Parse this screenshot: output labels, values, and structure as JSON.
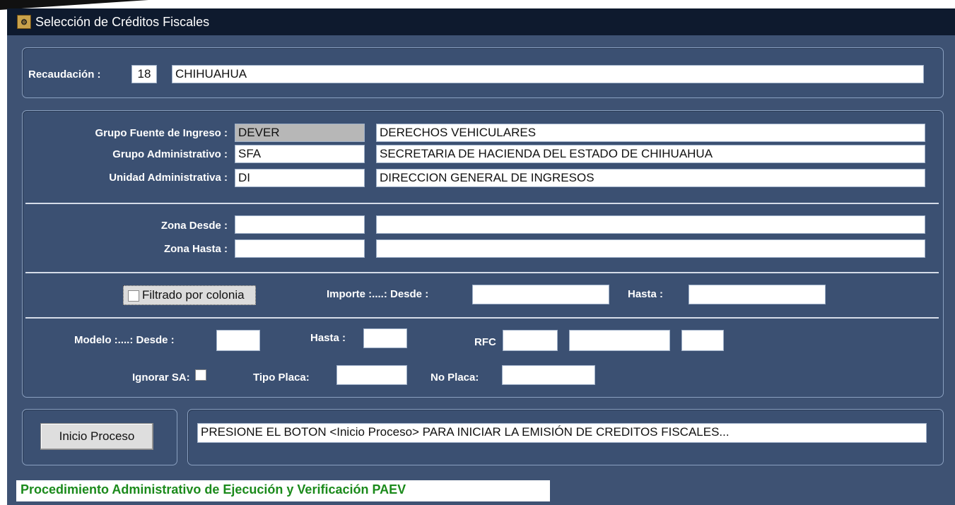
{
  "window": {
    "title": "Selección de Créditos Fiscales"
  },
  "recaudacion": {
    "label": "Recaudación :",
    "code": "18",
    "name": "CHIHUAHUA"
  },
  "grupo_fuente": {
    "label": "Grupo Fuente de Ingreso :",
    "code": "DEVER",
    "desc": "DERECHOS VEHICULARES"
  },
  "grupo_admin": {
    "label": "Grupo Administrativo :",
    "code": "SFA",
    "desc": "SECRETARIA DE HACIENDA DEL ESTADO DE CHIHUAHUA"
  },
  "unidad_admin": {
    "label": "Unidad Administrativa :",
    "code": "DI",
    "desc": "DIRECCION GENERAL DE INGRESOS"
  },
  "zona_desde": {
    "label": "Zona Desde :",
    "code": "",
    "desc": ""
  },
  "zona_hasta": {
    "label": "Zona Hasta :",
    "code": "",
    "desc": ""
  },
  "filtrado": {
    "label": "Filtrado por colonia",
    "checked": false
  },
  "importe": {
    "desde_label": "Importe :....: Desde :",
    "desde_value": "",
    "hasta_label": "Hasta :",
    "hasta_value": ""
  },
  "modelo": {
    "desde_label": "Modelo :....: Desde :",
    "desde_value": "",
    "hasta_label": "Hasta :",
    "hasta_value": ""
  },
  "rfc": {
    "label": "RFC",
    "part1": "",
    "part2": "",
    "part3": ""
  },
  "ignorar_sa": {
    "label": "Ignorar SA:",
    "checked": false
  },
  "tipo_placa": {
    "label": "Tipo Placa:",
    "value": ""
  },
  "no_placa": {
    "label": "No Placa:",
    "value": ""
  },
  "process": {
    "button_label": "Inicio Proceso",
    "message": "PRESIONE EL BOTON <Inicio Proceso> PARA INICIAR LA EMISIÓN DE CREDITOS FISCALES..."
  },
  "statusbar": {
    "text": "Procedimiento Administrativo de Ejecución y Verificación PAEV"
  }
}
